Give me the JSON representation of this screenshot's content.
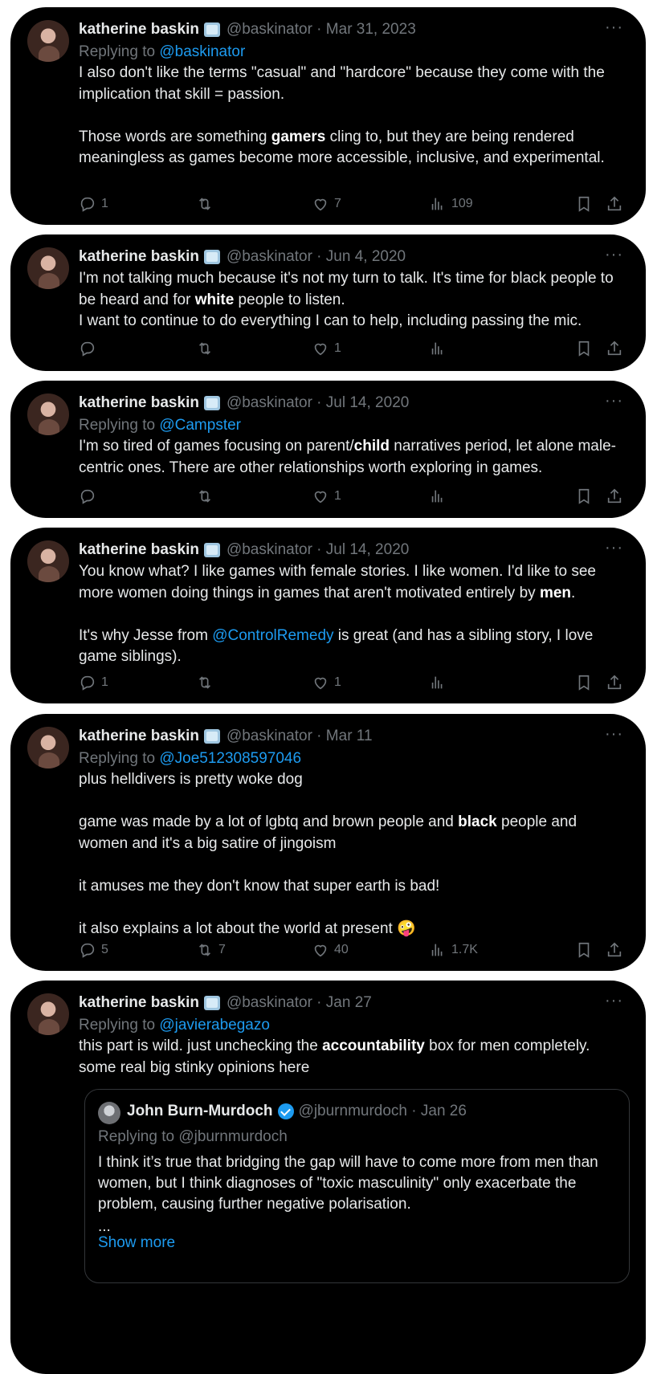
{
  "tweets": [
    {
      "name": "katherine baskin",
      "handle": "@baskinator",
      "date": "Mar 31, 2023",
      "replying_prefix": "Replying to ",
      "replying_to": "@baskinator",
      "body": [
        [
          "I also don't like the terms \"casual\" and \"hardcore\" because they come with the implication that skill = passion."
        ],
        [
          "Those words are something ",
          {
            "b": "gamers"
          },
          " cling to, but they are being rendered meaningless as games become more accessible, inclusive, and experimental."
        ]
      ],
      "stats": {
        "replies": "1",
        "retweets": "",
        "likes": "7",
        "views": "109"
      }
    },
    {
      "name": "katherine baskin",
      "handle": "@baskinator",
      "date": "Jun 4, 2020",
      "body": [
        [
          "I'm not talking much because it's not my turn to talk. It's time for black people to be heard and for ",
          {
            "b": "white"
          },
          " people to listen.",
          {
            "br": true
          },
          "I want to continue to do everything I can to help, including passing the mic."
        ]
      ],
      "stats": {
        "replies": "",
        "retweets": "",
        "likes": "1",
        "views": ""
      }
    },
    {
      "name": "katherine baskin",
      "handle": "@baskinator",
      "date": "Jul 14, 2020",
      "replying_prefix": "Replying to ",
      "replying_to": "@Campster",
      "body": [
        [
          "I'm so tired of games focusing on parent/",
          {
            "b": "child"
          },
          " narratives period, let alone male-centric ones. There are other relationships worth exploring in games."
        ]
      ],
      "stats": {
        "replies": "",
        "retweets": "",
        "likes": "1",
        "views": ""
      }
    },
    {
      "name": "katherine baskin",
      "handle": "@baskinator",
      "date": "Jul 14, 2020",
      "body": [
        [
          "You know what? I like games with female stories. I like women. I'd like to see more women doing things in games that aren't motivated entirely by ",
          {
            "b": "men"
          },
          "."
        ],
        [
          "It's why Jesse from ",
          {
            "link": "@ControlRemedy"
          },
          " is great (and has a sibling story, I love game siblings)."
        ]
      ],
      "stats": {
        "replies": "1",
        "retweets": "",
        "likes": "1",
        "views": ""
      }
    },
    {
      "name": "katherine baskin",
      "handle": "@baskinator",
      "date": "Mar 11",
      "replying_prefix": "Replying to ",
      "replying_to": "@Joe512308597046",
      "body": [
        [
          "plus helldivers is pretty woke dog"
        ],
        [
          "game was made by a lot of lgbtq and brown people and ",
          {
            "b": "black"
          },
          " people and women and it's a big satire of jingoism"
        ],
        [
          "it amuses me they don't know that super earth is bad!"
        ],
        [
          "it also explains a lot about the world at present 🤪"
        ]
      ],
      "stats": {
        "replies": "5",
        "retweets": "7",
        "likes": "40",
        "views": "1.7K"
      }
    },
    {
      "name": "katherine baskin",
      "handle": "@baskinator",
      "date": "Jan 27",
      "replying_prefix": "Replying to ",
      "replying_to": "@javierabegazo",
      "body": [
        [
          "this part is wild. just unchecking the ",
          {
            "b": "accountability"
          },
          " box for men completely. some real big stinky opinions here"
        ]
      ]
    }
  ],
  "quote": {
    "name": "John Burn-Murdoch",
    "handle": "@jburnmurdoch",
    "date": "Jan 26",
    "replying": "Replying to @jburnmurdoch",
    "body": "I think it’s true that bridging the gap will have to come more from men than women, but I think diagnoses of \"toxic masculinity\" only exacerbate the problem, causing further negative polarisation.",
    "ellipsis": "...",
    "show_more": "Show more"
  },
  "sep": " · ",
  "more_glyph": "···",
  "icons": [
    "reply-icon",
    "retweet-icon",
    "like-icon",
    "views-icon",
    "bookmark-icon",
    "share-icon"
  ]
}
